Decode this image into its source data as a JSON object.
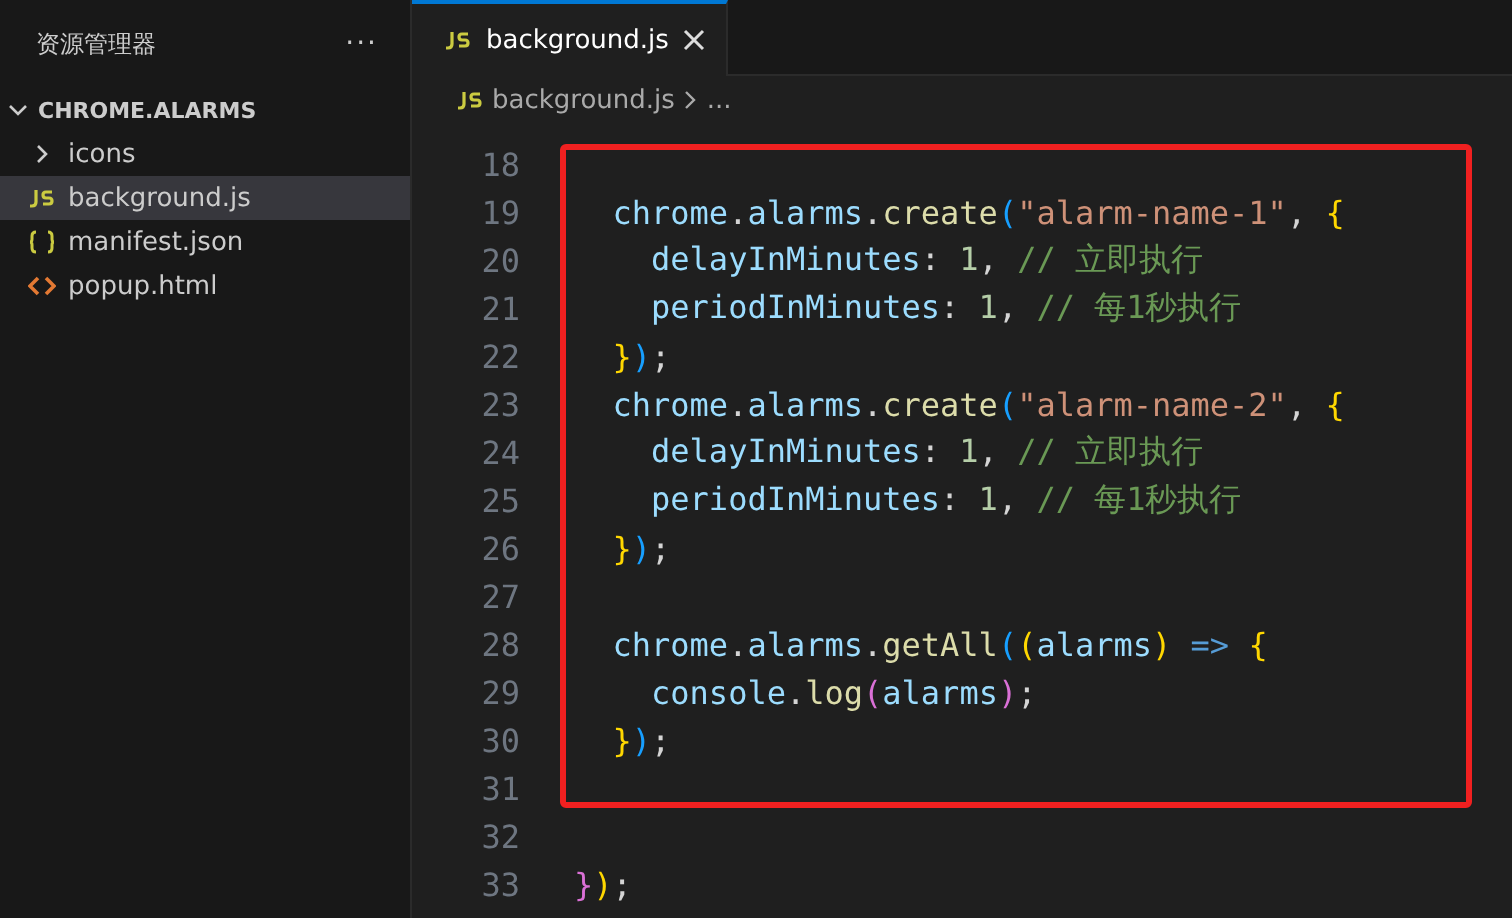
{
  "sidebar": {
    "title": "资源管理器",
    "more": "···",
    "folder": {
      "name": "CHROME.ALARMS",
      "expanded": true
    },
    "items": [
      {
        "kind": "folder",
        "name": "icons",
        "expanded": false,
        "selected": false
      },
      {
        "kind": "js",
        "name": "background.js",
        "selected": true
      },
      {
        "kind": "json",
        "name": "manifest.json",
        "selected": false
      },
      {
        "kind": "html",
        "name": "popup.html",
        "selected": false
      }
    ]
  },
  "tabs": [
    {
      "name": "background.js",
      "selected": true
    }
  ],
  "breadcrumb": {
    "file": "background.js",
    "rest": "..."
  },
  "editor": {
    "boxed_lines": [
      {
        "n": "18"
      },
      {
        "n": "19",
        "tokens": [
          {
            "t": "  chrome",
            "kind": "var"
          },
          {
            "t": ".",
            "kind": "p"
          },
          {
            "t": "alarms",
            "kind": "var"
          },
          {
            "t": ".",
            "kind": "p"
          },
          {
            "t": "create",
            "kind": "fn"
          },
          {
            "t": "(",
            "kind": "b3"
          },
          {
            "t": "\"alarm-name-1\"",
            "kind": "str"
          },
          {
            "t": ", ",
            "kind": "p"
          },
          {
            "t": "{",
            "kind": "b1"
          }
        ]
      },
      {
        "n": "20",
        "tokens": [
          {
            "t": "    delayInMinutes",
            "kind": "var"
          },
          {
            "t": ": ",
            "kind": "p"
          },
          {
            "t": "1",
            "kind": "num"
          },
          {
            "t": ", ",
            "kind": "p"
          },
          {
            "t": "// 立即执行",
            "kind": "com"
          }
        ]
      },
      {
        "n": "21",
        "tokens": [
          {
            "t": "    periodInMinutes",
            "kind": "var"
          },
          {
            "t": ": ",
            "kind": "p"
          },
          {
            "t": "1",
            "kind": "num"
          },
          {
            "t": ", ",
            "kind": "p"
          },
          {
            "t": "// 每1秒执行",
            "kind": "com"
          }
        ]
      },
      {
        "n": "22",
        "tokens": [
          {
            "t": "  }",
            "kind": "b1"
          },
          {
            "t": ")",
            "kind": "b3"
          },
          {
            "t": ";",
            "kind": "p"
          }
        ]
      },
      {
        "n": "23",
        "tokens": [
          {
            "t": "  chrome",
            "kind": "var"
          },
          {
            "t": ".",
            "kind": "p"
          },
          {
            "t": "alarms",
            "kind": "var"
          },
          {
            "t": ".",
            "kind": "p"
          },
          {
            "t": "create",
            "kind": "fn"
          },
          {
            "t": "(",
            "kind": "b3"
          },
          {
            "t": "\"alarm-name-2\"",
            "kind": "str"
          },
          {
            "t": ", ",
            "kind": "p"
          },
          {
            "t": "{",
            "kind": "b1"
          }
        ]
      },
      {
        "n": "24",
        "tokens": [
          {
            "t": "    delayInMinutes",
            "kind": "var"
          },
          {
            "t": ": ",
            "kind": "p"
          },
          {
            "t": "1",
            "kind": "num"
          },
          {
            "t": ", ",
            "kind": "p"
          },
          {
            "t": "// 立即执行",
            "kind": "com"
          }
        ]
      },
      {
        "n": "25",
        "tokens": [
          {
            "t": "    periodInMinutes",
            "kind": "var"
          },
          {
            "t": ": ",
            "kind": "p"
          },
          {
            "t": "1",
            "kind": "num"
          },
          {
            "t": ", ",
            "kind": "p"
          },
          {
            "t": "// 每1秒执行",
            "kind": "com"
          }
        ]
      },
      {
        "n": "26",
        "tokens": [
          {
            "t": "  }",
            "kind": "b1"
          },
          {
            "t": ")",
            "kind": "b3"
          },
          {
            "t": ";",
            "kind": "p"
          }
        ]
      },
      {
        "n": "27"
      },
      {
        "n": "28",
        "tokens": [
          {
            "t": "  chrome",
            "kind": "var"
          },
          {
            "t": ".",
            "kind": "p"
          },
          {
            "t": "alarms",
            "kind": "var"
          },
          {
            "t": ".",
            "kind": "p"
          },
          {
            "t": "getAll",
            "kind": "fn"
          },
          {
            "t": "(",
            "kind": "b3"
          },
          {
            "t": "(",
            "kind": "b1"
          },
          {
            "t": "alarms",
            "kind": "var"
          },
          {
            "t": ")",
            "kind": "b1"
          },
          {
            "t": " => ",
            "kind": "kw"
          },
          {
            "t": "{",
            "kind": "b1"
          }
        ]
      },
      {
        "n": "29",
        "tokens": [
          {
            "t": "    console",
            "kind": "var"
          },
          {
            "t": ".",
            "kind": "p"
          },
          {
            "t": "log",
            "kind": "fn"
          },
          {
            "t": "(",
            "kind": "b2"
          },
          {
            "t": "alarms",
            "kind": "var"
          },
          {
            "t": ")",
            "kind": "b2"
          },
          {
            "t": ";",
            "kind": "p"
          }
        ]
      },
      {
        "n": "30",
        "tokens": [
          {
            "t": "  }",
            "kind": "b1"
          },
          {
            "t": ")",
            "kind": "b3"
          },
          {
            "t": ";",
            "kind": "p"
          }
        ]
      },
      {
        "n": "31"
      }
    ],
    "lines_after": [
      {
        "n": "32"
      },
      {
        "n": "33",
        "tokens": [
          {
            "t": "}",
            "kind": "b2"
          },
          {
            "t": ")",
            "kind": "b1"
          },
          {
            "t": ";",
            "kind": "p"
          }
        ]
      }
    ]
  }
}
